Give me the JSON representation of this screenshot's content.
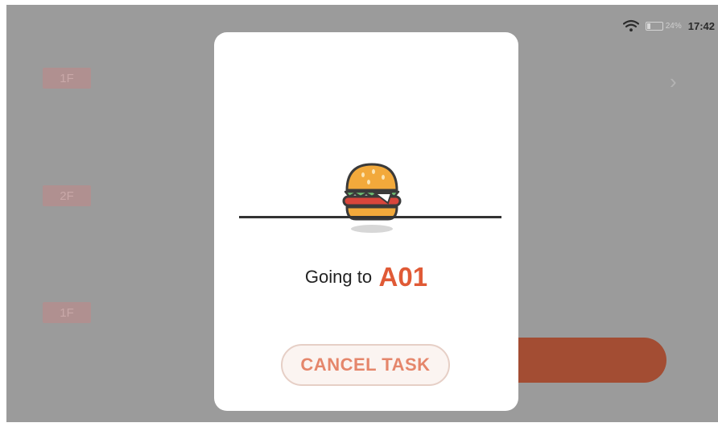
{
  "status_bar": {
    "battery_percent": "24%",
    "battery_level": 0.24,
    "time": "17:42"
  },
  "background": {
    "floors": [
      "1F",
      "2F",
      "1F"
    ]
  },
  "dialog": {
    "status_prefix": "Going to",
    "destination": "A01",
    "cancel_label": "CANCEL TASK",
    "icon": "burger-icon"
  },
  "colors": {
    "accent": "#e05a36",
    "cancel_text": "#e5866b",
    "overlay": "#9b9b9b"
  }
}
